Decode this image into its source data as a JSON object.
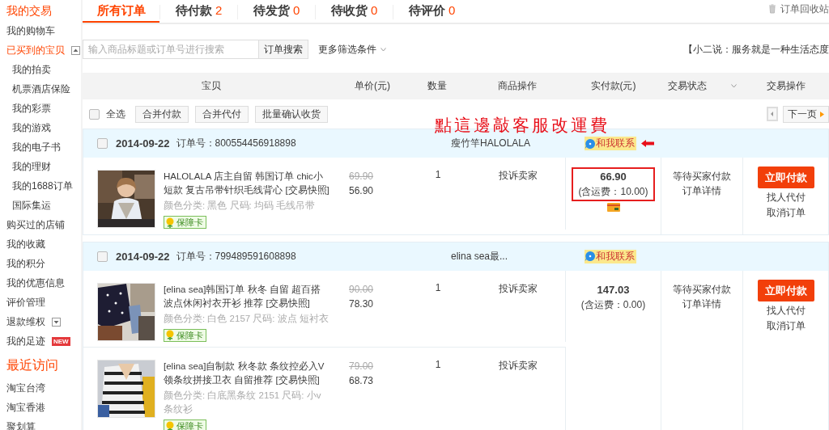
{
  "sidebar": {
    "sections": [
      {
        "title": "我的交易",
        "items": [
          {
            "label": "我的购物车",
            "selected": false
          },
          {
            "label": "已买到的宝贝",
            "selected": true,
            "expanded": true,
            "children": [
              {
                "label": "我的拍卖",
                "selected": false
              },
              {
                "label": "机票酒店保险",
                "selected": false
              },
              {
                "label": "我的彩票",
                "selected": false
              },
              {
                "label": "我的游戏",
                "selected": false
              },
              {
                "label": "我的电子书",
                "selected": false
              },
              {
                "label": "我的理财",
                "selected": false
              },
              {
                "label": "我的1688订单",
                "selected": false
              },
              {
                "label": "国际集运",
                "selected": false
              }
            ]
          },
          {
            "label": "购买过的店铺",
            "selected": false
          },
          {
            "label": "我的收藏",
            "selected": false
          },
          {
            "label": "我的积分",
            "selected": false
          },
          {
            "label": "我的优惠信息",
            "selected": false
          },
          {
            "label": "评价管理",
            "selected": false
          },
          {
            "label": "退款维权",
            "selected": false,
            "expanded": false
          },
          {
            "label": "我的足迹",
            "selected": false,
            "badge": "NEW"
          }
        ]
      },
      {
        "title": "最近访问",
        "items": [
          {
            "label": "淘宝台湾",
            "selected": false
          },
          {
            "label": "淘宝香港",
            "selected": false
          },
          {
            "label": "聚划算",
            "selected": false
          }
        ]
      }
    ]
  },
  "tabs": [
    {
      "label": "所有订单",
      "selected": true
    },
    {
      "label": "待付款",
      "count": "2",
      "selected": false
    },
    {
      "label": "待发货",
      "count": "0",
      "selected": false
    },
    {
      "label": "待收货",
      "count": "0",
      "selected": false
    },
    {
      "label": "待评价",
      "count": "0",
      "selected": false
    }
  ],
  "recycle_bin": "订单回收站",
  "search": {
    "placeholder": "输入商品标题或订单号进行搜索",
    "button": "订单搜索",
    "filter": "更多筛选条件"
  },
  "notice": "【小二说：服务就是一种生活态度",
  "columns": [
    "宝贝",
    "单价(元)",
    "数量",
    "商品操作",
    "实付款(元)",
    "交易状态",
    "交易操作"
  ],
  "toolbar": {
    "select_all": {
      "label": "全选",
      "checked": false
    },
    "buttons": [
      "合并付款",
      "合并代付",
      "批量确认收货"
    ],
    "next_page": "下一页"
  },
  "annotation": "點這邊敲客服改運費",
  "orders": [
    {
      "checked": false,
      "date": "2014-09-22",
      "order_no_label": "订单号：",
      "order_no": "800554456918898",
      "shop": "瘦竹竿HALOLALA",
      "contact": "和我联系",
      "contact_marked": true,
      "items": [
        {
          "title": "HALOLALA 店主自留 韩国订单 chic小短款 复古吊带针织毛线背心 [交易快照]",
          "spec": "颜色分类: 黑色 尺码: 均码 毛线吊带",
          "badge": "保障卡",
          "original_price": "69.90",
          "price": "56.90",
          "quantity": "1",
          "action": "投诉卖家"
        }
      ],
      "total": "66.90",
      "shipping": "(含运费：10.00)",
      "total_marked": true,
      "card_icon": true,
      "status": "等待买家付款",
      "detail": "订单详情",
      "pay": "立即付款",
      "links": [
        "找人代付",
        "取消订单"
      ]
    },
    {
      "checked": false,
      "date": "2014-09-22",
      "order_no_label": "订单号：",
      "order_no": "799489591608898",
      "shop": "elina sea最...",
      "contact": "和我联系",
      "contact_marked": false,
      "items": [
        {
          "title": "[elina sea]韩国订单 秋冬 自留 超百搭波点休闲衬衣开衫 推荐 [交易快照]",
          "spec": "颜色分类: 白色 2157 尺码: 波点 短衬衣",
          "badge": "保障卡",
          "original_price": "90.00",
          "price": "78.30",
          "quantity": "1",
          "action": "投诉卖家"
        },
        {
          "title": "[elina sea]自制款 秋冬款 条纹控必入V领条纹拼接卫衣 自留推荐 [交易快照]",
          "spec": "颜色分类: 白底黑条纹 2151 尺码: 小v条纹衫",
          "badge": "保障卡",
          "original_price": "79.00",
          "price": "68.73",
          "quantity": "1",
          "action": "投诉卖家"
        }
      ],
      "total": "147.03",
      "shipping": "(含运费：0.00)",
      "total_marked": false,
      "card_icon": false,
      "status": "等待买家付款",
      "detail": "订单详情",
      "pay": "立即付款",
      "links": [
        "找人代付",
        "取消订单"
      ]
    }
  ]
}
